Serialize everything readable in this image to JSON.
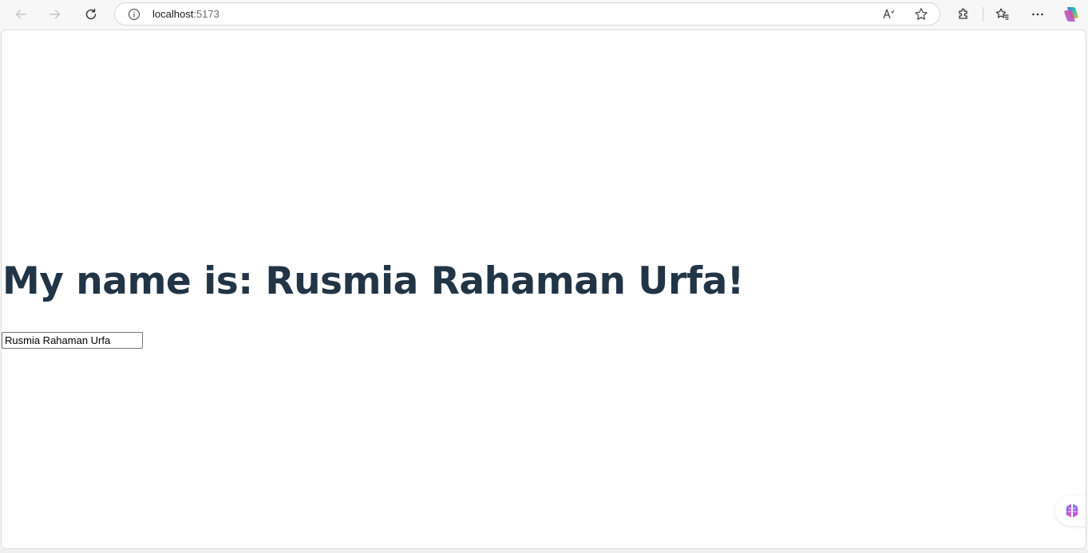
{
  "browser": {
    "url_host": "localhost",
    "url_port": ":5173",
    "icons": {
      "back": "back-arrow-icon",
      "forward": "forward-arrow-icon",
      "refresh": "refresh-icon",
      "site_info": "info-icon",
      "read_aloud": "read-aloud-icon",
      "favorite": "star-icon",
      "extensions": "puzzle-icon",
      "favorites": "favorites-icon",
      "more": "more-icon",
      "copilot": "copilot-icon"
    }
  },
  "page": {
    "heading": "My name is: Rusmia Rahaman Urfa!",
    "input_value": "Rusmia Rahaman Urfa",
    "heading_color": "#213547"
  },
  "sidebar": {
    "icon": "brain-icon"
  }
}
